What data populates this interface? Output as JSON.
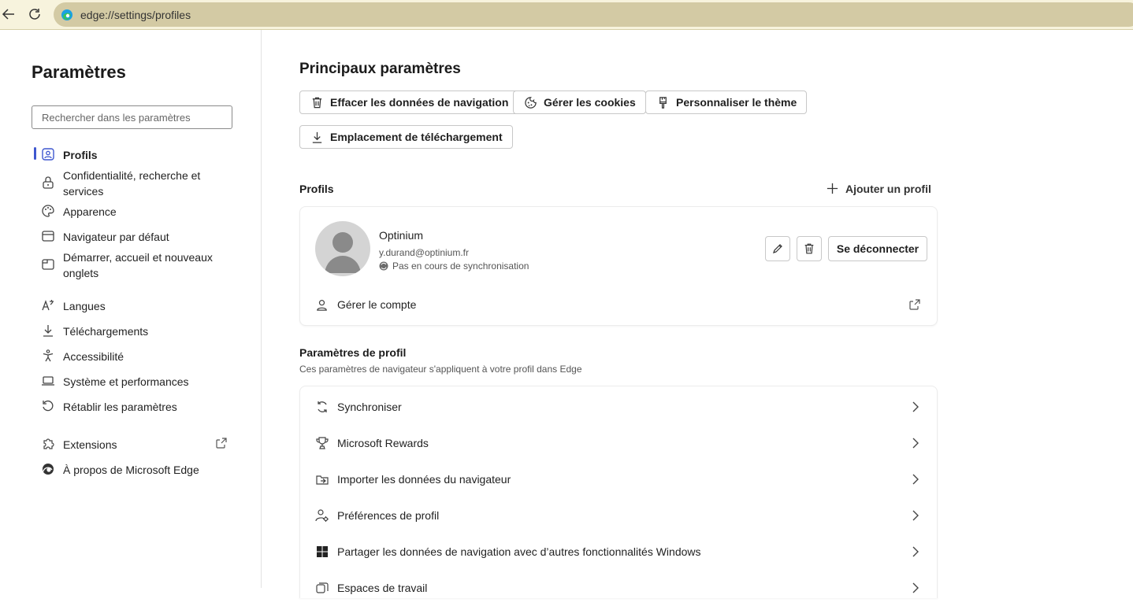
{
  "browser": {
    "url": "edge://settings/profiles"
  },
  "sidebar": {
    "title": "Paramètres",
    "search_placeholder": "Rechercher dans les paramètres",
    "items": [
      {
        "label": "Profils",
        "icon": "profile-icon",
        "active": true
      },
      {
        "label": "Confidentialité, recherche et services",
        "icon": "lock-icon"
      },
      {
        "label": "Apparence",
        "icon": "palette-icon"
      },
      {
        "label": "Navigateur par défaut",
        "icon": "browser-icon"
      },
      {
        "label": "Démarrer, accueil et nouveaux onglets",
        "icon": "tabs-icon"
      },
      {
        "label": "Langues",
        "icon": "language-icon"
      },
      {
        "label": "Téléchargements",
        "icon": "download-icon"
      },
      {
        "label": "Accessibilité",
        "icon": "accessibility-icon"
      },
      {
        "label": "Système et performances",
        "icon": "laptop-icon"
      },
      {
        "label": "Rétablir les paramètres",
        "icon": "reset-icon"
      },
      {
        "label": "Extensions",
        "icon": "puzzle-icon"
      },
      {
        "label": "À propos de Microsoft Edge",
        "icon": "edge-logo-icon"
      }
    ]
  },
  "main": {
    "title": "Principaux paramètres",
    "quick_actions": [
      {
        "label": "Effacer les données de navigation",
        "icon": "trash-icon"
      },
      {
        "label": "Gérer les cookies",
        "icon": "cookie-icon"
      },
      {
        "label": "Personnaliser le thème",
        "icon": "brush-icon"
      },
      {
        "label": "Emplacement de téléchargement",
        "icon": "download-icon"
      }
    ],
    "profiles_section": {
      "title": "Profils",
      "add_label": "Ajouter un profil",
      "profile": {
        "name": "Optinium",
        "email": "y.durand@optinium.fr",
        "sync_status": "Pas en cours de synchronisation",
        "logout_label": "Se déconnecter",
        "manage_label": "Gérer le compte"
      }
    },
    "profile_settings": {
      "title": "Paramètres de profil",
      "subtitle": "Ces paramètres de navigateur s'appliquent à votre profil dans Edge",
      "rows": [
        {
          "label": "Synchroniser",
          "icon": "sync-icon"
        },
        {
          "label": "Microsoft Rewards",
          "icon": "trophy-icon"
        },
        {
          "label": "Importer les données du navigateur",
          "icon": "import-icon"
        },
        {
          "label": "Préférences de profil",
          "icon": "profile-settings-icon"
        },
        {
          "label": "Partager les données de navigation avec d’autres fonctionnalités Windows",
          "icon": "windows-icon"
        },
        {
          "label": "Espaces de travail",
          "icon": "workspaces-icon"
        }
      ]
    }
  },
  "colors": {
    "accent": "#3e57cf",
    "topbar": "#f7f3dd",
    "address_bar": "#d3caa4"
  }
}
